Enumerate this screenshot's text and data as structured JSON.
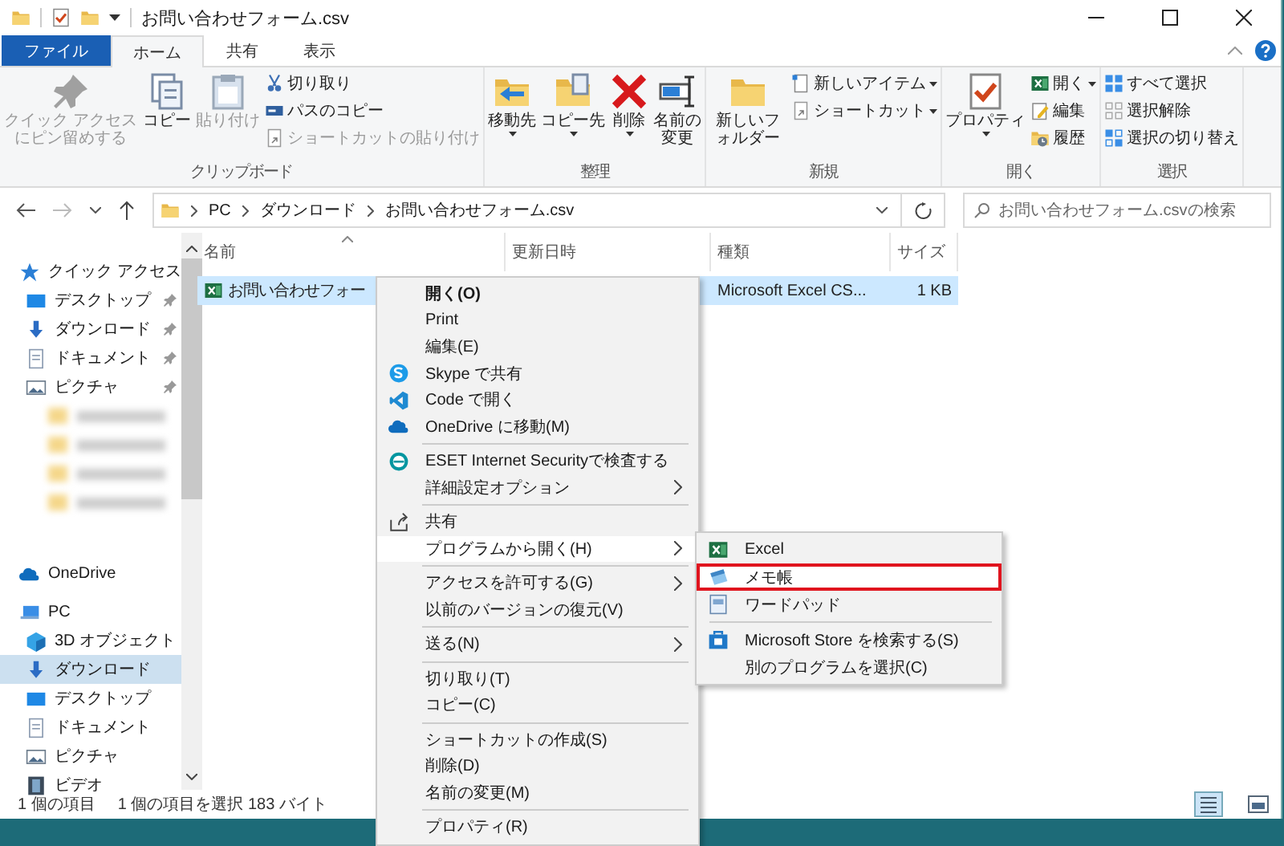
{
  "window": {
    "title": "お問い合わせフォーム.csv"
  },
  "ribbon_tabs": [
    {
      "label": "ファイル",
      "kind": "file",
      "selected": false
    },
    {
      "label": "ホーム",
      "kind": "tab",
      "selected": true
    },
    {
      "label": "共有",
      "kind": "tab",
      "selected": false
    },
    {
      "label": "表示",
      "kind": "tab",
      "selected": false
    }
  ],
  "ribbon_groups": [
    {
      "label": "クリップボード",
      "commands": [
        {
          "kind": "large",
          "label": "クイック アクセスにピン留めする",
          "disabled": true,
          "dropdown": false
        },
        {
          "kind": "large",
          "label": "コピー",
          "disabled": false,
          "dropdown": false
        },
        {
          "kind": "large",
          "label": "貼り付け",
          "disabled": true,
          "dropdown": false
        },
        {
          "kind": "small",
          "label": "切り取り",
          "disabled": false,
          "dropdown": false
        },
        {
          "kind": "small",
          "label": "パスのコピー",
          "disabled": false,
          "dropdown": false
        },
        {
          "kind": "small",
          "label": "ショートカットの貼り付け",
          "disabled": true,
          "dropdown": false
        }
      ]
    },
    {
      "label": "整理",
      "commands": [
        {
          "kind": "large",
          "label": "移動先",
          "disabled": false,
          "dropdown": true
        },
        {
          "kind": "large",
          "label": "コピー先",
          "disabled": false,
          "dropdown": true
        },
        {
          "kind": "large",
          "label": "削除",
          "disabled": false,
          "dropdown": true
        },
        {
          "kind": "large",
          "label": "名前の変更",
          "disabled": false,
          "dropdown": false
        }
      ]
    },
    {
      "label": "新規",
      "commands": [
        {
          "kind": "large",
          "label": "新しいフォルダー",
          "disabled": false,
          "dropdown": false
        },
        {
          "kind": "small",
          "label": "新しいアイテム",
          "disabled": false,
          "dropdown": true
        },
        {
          "kind": "small",
          "label": "ショートカット",
          "disabled": false,
          "dropdown": true
        }
      ]
    },
    {
      "label": "開く",
      "commands": [
        {
          "kind": "large",
          "label": "プロパティ",
          "disabled": false,
          "dropdown": true
        },
        {
          "kind": "small",
          "label": "開く",
          "disabled": false,
          "dropdown": true
        },
        {
          "kind": "small",
          "label": "編集",
          "disabled": false,
          "dropdown": false
        },
        {
          "kind": "small",
          "label": "履歴",
          "disabled": false,
          "dropdown": false
        }
      ]
    },
    {
      "label": "選択",
      "commands": [
        {
          "kind": "small",
          "label": "すべて選択",
          "disabled": false,
          "dropdown": false
        },
        {
          "kind": "small",
          "label": "選択解除",
          "disabled": false,
          "dropdown": false
        },
        {
          "kind": "small",
          "label": "選択の切り替え",
          "disabled": false,
          "dropdown": false
        }
      ]
    }
  ],
  "address_bar": {
    "path": [
      "PC",
      "ダウンロード",
      "お問い合わせフォーム.csv"
    ]
  },
  "search": {
    "placeholder": "お問い合わせフォーム.csvの検索"
  },
  "sidebar": {
    "items": [
      {
        "kind": "item",
        "label": "クイック アクセス",
        "selected": false,
        "children": [
          {
            "kind": "item",
            "label": "デスクトップ",
            "pinned": true,
            "selected": false
          },
          {
            "kind": "item",
            "label": "ダウンロード",
            "pinned": true,
            "selected": false
          },
          {
            "kind": "item",
            "label": "ドキュメント",
            "pinned": true,
            "selected": false
          },
          {
            "kind": "item",
            "label": "ピクチャ",
            "pinned": true,
            "selected": false
          },
          {
            "kind": "blurred"
          },
          {
            "kind": "blurred"
          },
          {
            "kind": "blurred"
          },
          {
            "kind": "blurred"
          }
        ]
      },
      {
        "kind": "item",
        "label": "OneDrive",
        "selected": false
      },
      {
        "kind": "item",
        "label": "PC",
        "selected": false,
        "children": [
          {
            "kind": "item",
            "label": "3D オブジェクト",
            "pinned": false,
            "selected": false
          },
          {
            "kind": "item",
            "label": "ダウンロード",
            "pinned": false,
            "selected": true
          },
          {
            "kind": "item",
            "label": "デスクトップ",
            "pinned": false,
            "selected": false
          },
          {
            "kind": "item",
            "label": "ドキュメント",
            "pinned": false,
            "selected": false
          },
          {
            "kind": "item",
            "label": "ピクチャ",
            "pinned": false,
            "selected": false
          },
          {
            "kind": "item",
            "label": "ビデオ",
            "pinned": false,
            "selected": false
          }
        ]
      }
    ]
  },
  "file_list": {
    "columns": [
      "名前",
      "更新日時",
      "種類",
      "サイズ"
    ],
    "rows": [
      {
        "name": "お問い合わせフォー",
        "type": "Microsoft Excel CS...",
        "size": "1 KB",
        "selected": true
      }
    ]
  },
  "status_bar": {
    "count": "1 個の項目",
    "selection": "1 個の項目を選択  183 バイト"
  },
  "context_menu": {
    "items": [
      {
        "kind": "item",
        "label": "開く(O)",
        "bold": true,
        "submenu": false,
        "selected": false
      },
      {
        "kind": "item",
        "label": "Print",
        "bold": false,
        "submenu": false,
        "selected": false
      },
      {
        "kind": "item",
        "label": "編集(E)",
        "bold": false,
        "submenu": false,
        "selected": false
      },
      {
        "kind": "item",
        "label": "Skype で共有",
        "bold": false,
        "submenu": false,
        "selected": false
      },
      {
        "kind": "item",
        "label": "Code で開く",
        "bold": false,
        "submenu": false,
        "selected": false
      },
      {
        "kind": "item",
        "label": "OneDrive に移動(M)",
        "bold": false,
        "submenu": false,
        "selected": false
      },
      {
        "kind": "separator"
      },
      {
        "kind": "item",
        "label": "ESET Internet Securityで検査する",
        "bold": false,
        "submenu": false,
        "selected": false
      },
      {
        "kind": "item",
        "label": "詳細設定オプション",
        "bold": false,
        "submenu": true,
        "selected": false
      },
      {
        "kind": "separator"
      },
      {
        "kind": "item",
        "label": "共有",
        "bold": false,
        "submenu": false,
        "selected": false
      },
      {
        "kind": "item",
        "label": "プログラムから開く(H)",
        "bold": false,
        "submenu": true,
        "selected": true
      },
      {
        "kind": "separator"
      },
      {
        "kind": "item",
        "label": "アクセスを許可する(G)",
        "bold": false,
        "submenu": true,
        "selected": false
      },
      {
        "kind": "item",
        "label": "以前のバージョンの復元(V)",
        "bold": false,
        "submenu": false,
        "selected": false
      },
      {
        "kind": "separator"
      },
      {
        "kind": "item",
        "label": "送る(N)",
        "bold": false,
        "submenu": true,
        "selected": false
      },
      {
        "kind": "separator"
      },
      {
        "kind": "item",
        "label": "切り取り(T)",
        "bold": false,
        "submenu": false,
        "selected": false
      },
      {
        "kind": "item",
        "label": "コピー(C)",
        "bold": false,
        "submenu": false,
        "selected": false
      },
      {
        "kind": "separator"
      },
      {
        "kind": "item",
        "label": "ショートカットの作成(S)",
        "bold": false,
        "submenu": false,
        "selected": false
      },
      {
        "kind": "item",
        "label": "削除(D)",
        "bold": false,
        "submenu": false,
        "selected": false
      },
      {
        "kind": "item",
        "label": "名前の変更(M)",
        "bold": false,
        "submenu": false,
        "selected": false
      },
      {
        "kind": "separator"
      },
      {
        "kind": "item",
        "label": "プロパティ(R)",
        "bold": false,
        "submenu": false,
        "selected": false
      }
    ]
  },
  "open_with_menu": {
    "items": [
      {
        "kind": "item",
        "label": "Excel",
        "marked": false
      },
      {
        "kind": "item",
        "label": "メモ帳",
        "marked": true
      },
      {
        "kind": "item",
        "label": "ワードパッド",
        "marked": false
      },
      {
        "kind": "separator"
      },
      {
        "kind": "item",
        "label": "Microsoft Store を検索する(S)",
        "marked": false
      },
      {
        "kind": "item",
        "label": "別のプログラムを選択(C)",
        "marked": false
      }
    ]
  }
}
